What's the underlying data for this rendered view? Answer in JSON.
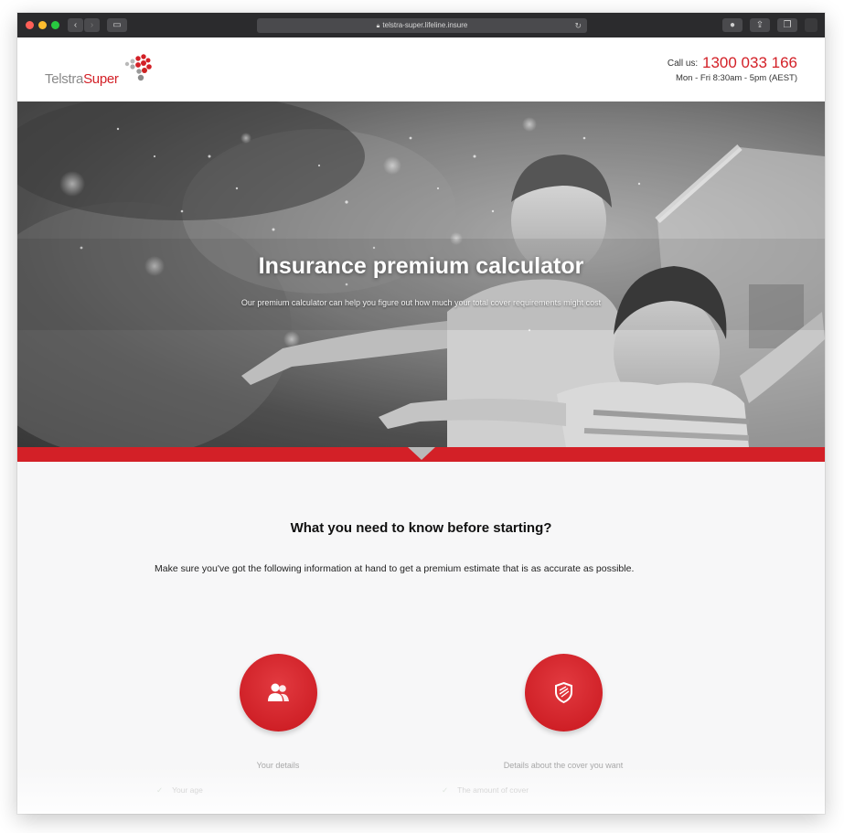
{
  "browser": {
    "url": "telstra-super.lifeline.insure"
  },
  "header": {
    "logo_part1": "Telstra",
    "logo_part2": "Super",
    "call_label": "Call us:",
    "phone": "1300 033 166",
    "hours": "Mon - Fri 8:30am - 5pm (AEST)"
  },
  "hero": {
    "title": "Insurance premium calculator",
    "subtitle": "Our premium calculator can help you figure out how much your total cover requirements might cost"
  },
  "content": {
    "heading": "What you need to know before starting?",
    "intro": "Make sure you've got the following information at hand to get a premium estimate that is as accurate as possible.",
    "features": [
      {
        "label": "Your details",
        "icon": "users-icon",
        "items": [
          "Your age"
        ]
      },
      {
        "label": "Details about the cover you want",
        "icon": "shield-icon",
        "items": [
          "The amount of cover"
        ]
      }
    ]
  },
  "colors": {
    "brand_red": "#d32027",
    "chrome_dark": "#2b2b2d"
  }
}
